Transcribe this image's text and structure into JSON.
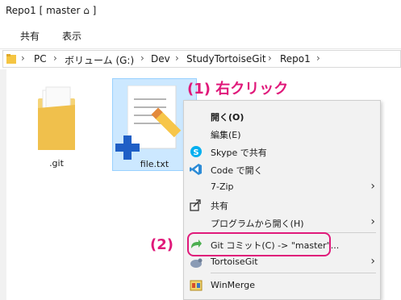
{
  "window": {
    "title": "Repo1 [ master ⌂ ]"
  },
  "ribbon": {
    "tabs": [
      "共有",
      "表示"
    ]
  },
  "address": {
    "crumbs": [
      "PC",
      "ボリューム (G:)",
      "Dev",
      "StudyTortoiseGit",
      "Repo1"
    ]
  },
  "files": [
    {
      "name": ".git",
      "icon": "folder-icon"
    },
    {
      "name": "file.txt",
      "icon": "text-file-icon",
      "selected": true
    }
  ],
  "annotations": {
    "step1": "(1) 右クリック",
    "step2": "(2)"
  },
  "context_menu": {
    "items": [
      {
        "label": "開く(O)",
        "bold": true,
        "icon": "",
        "submenu": false
      },
      {
        "label": "編集(E)",
        "icon": "",
        "submenu": false
      },
      {
        "label": "Skype で共有",
        "icon": "skype-icon",
        "submenu": false
      },
      {
        "label": "Code で開く",
        "icon": "vscode-icon",
        "submenu": false
      },
      {
        "label": "7-Zip",
        "icon": "",
        "submenu": true
      },
      {
        "label": "共有",
        "icon": "share-icon",
        "submenu": false
      },
      {
        "label": "プログラムから開く(H)",
        "icon": "",
        "submenu": true
      },
      {
        "label": "Git コミット(C) -> \"master\"...",
        "icon": "git-commit-icon",
        "submenu": false
      },
      {
        "label": "TortoiseGit",
        "icon": "tortoisegit-icon",
        "submenu": true
      },
      {
        "label": "WinMerge",
        "icon": "winmerge-icon",
        "submenu": false
      }
    ]
  },
  "colors": {
    "annotation": "#e0197a",
    "selection": "#cce8ff",
    "menu_bg": "#f2f2f2"
  }
}
